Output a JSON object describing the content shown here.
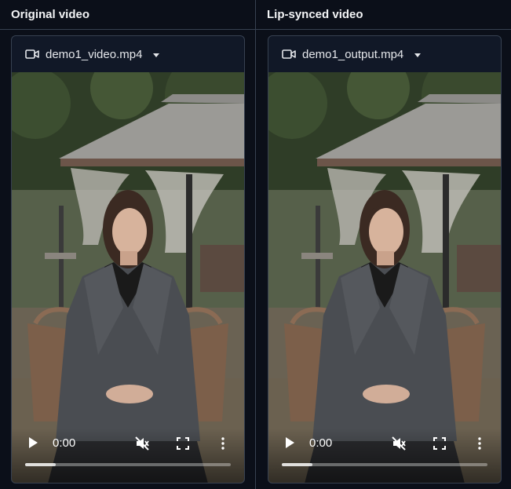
{
  "panels": [
    {
      "title": "Original video",
      "file_name": "demo1_video.mp4",
      "time": "0:00",
      "buffered_fraction": 0.15
    },
    {
      "title": "Lip-synced video",
      "file_name": "demo1_output.mp4",
      "time": "0:00",
      "buffered_fraction": 0.15
    }
  ],
  "icons": {
    "file": "video-camera-icon",
    "dropdown": "chevron-down-icon",
    "play": "play-icon",
    "mute": "muted-speaker-icon",
    "fullscreen": "fullscreen-icon",
    "more": "more-vertical-icon"
  },
  "colors": {
    "background": "#0b0f19",
    "card": "#111827",
    "border": "#374151",
    "text": "#e5e7eb"
  }
}
